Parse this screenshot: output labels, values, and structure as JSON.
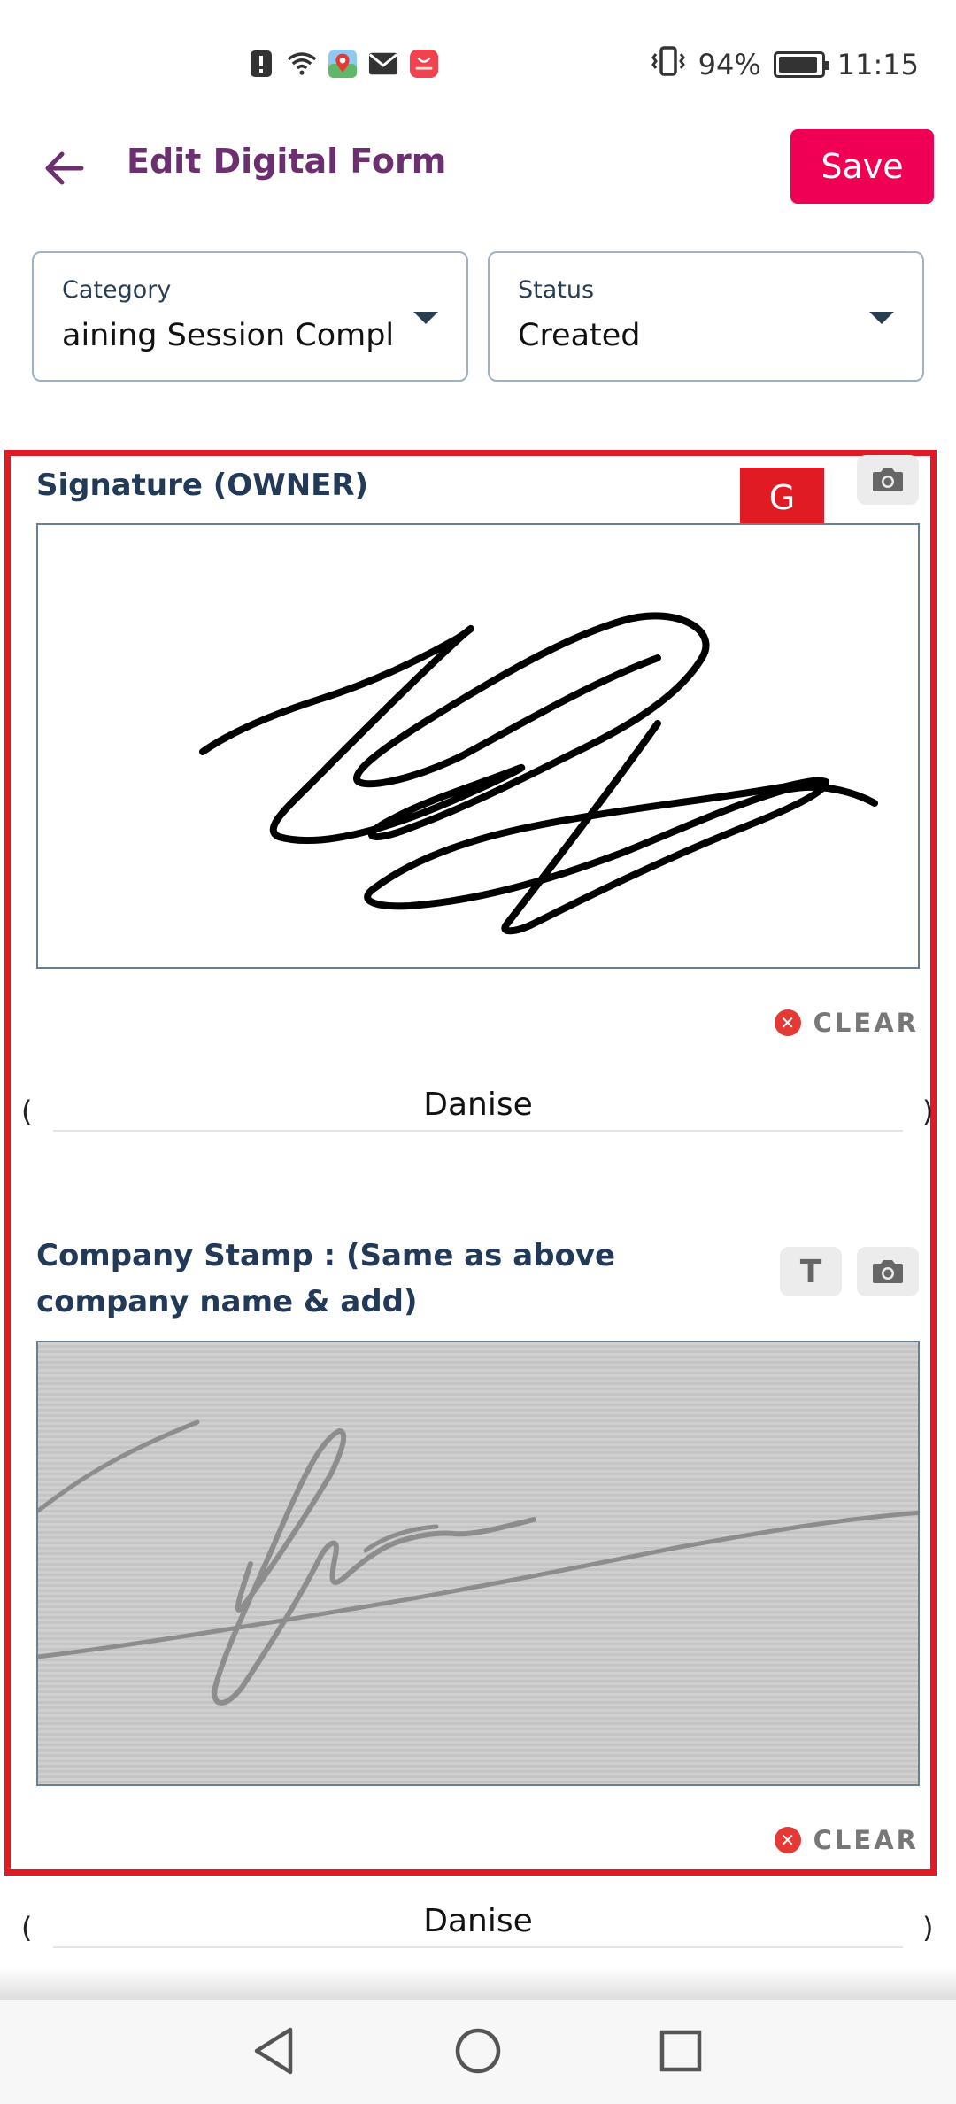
{
  "status_bar": {
    "battery": "94%",
    "battery_level": 0.94,
    "time": "11:15",
    "icons": [
      "alert-icon",
      "wifi-icon",
      "maps-icon",
      "mail-icon",
      "huawei-appgallery-icon",
      "vibrate-icon",
      "battery-icon"
    ]
  },
  "app_bar": {
    "back_icon": "arrow-left-icon",
    "title": "Edit Digital Form",
    "save_label": "Save"
  },
  "filters": {
    "category": {
      "label": "Category",
      "value": "aining Session Compl"
    },
    "status": {
      "label": "Status",
      "value": "Created"
    }
  },
  "badge": {
    "label": "G"
  },
  "signature_section": {
    "title": "Signature (OWNER)",
    "clear_label": "CLEAR",
    "name_value": "Danise",
    "open_paren": "(",
    "close_paren": ")"
  },
  "stamp_section": {
    "title": "Company Stamp : (Same as above company name & add)",
    "text_tool_label": "T",
    "clear_label": "CLEAR",
    "name_value": "Danise",
    "open_paren": "(",
    "close_paren": ")"
  },
  "colors": {
    "accent": "#6c2f6f",
    "save": "#ef0055",
    "highlight": "#e11b23",
    "section_title": "#223a57"
  }
}
